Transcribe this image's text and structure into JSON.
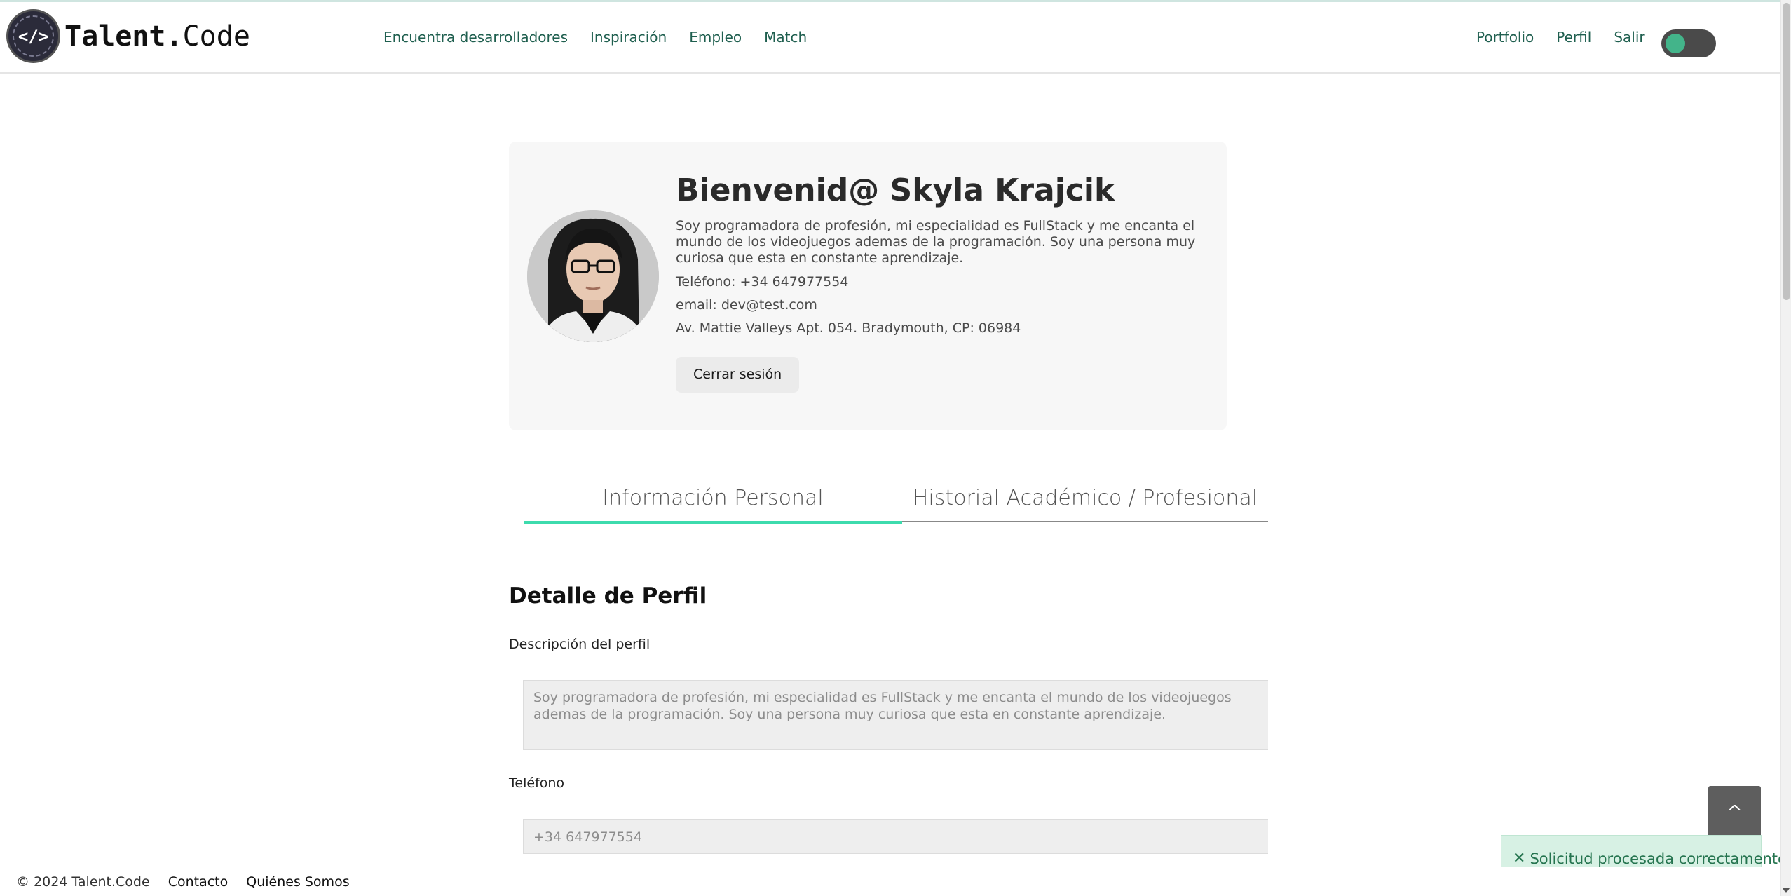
{
  "header": {
    "logo_icon": "</>",
    "logo_bold": "Talent.",
    "logo_rest": "Code",
    "nav_left": [
      "Encuentra desarrolladores",
      "Inspiración",
      "Empleo",
      "Match"
    ],
    "nav_right": [
      "Portfolio",
      "Perfil",
      "Salir"
    ],
    "theme_toggle": "on"
  },
  "profile": {
    "welcome": "Bienvenid@ Skyla Krajcik",
    "bio": "Soy programadora de profesión, mi especialidad es FullStack y me encanta el mundo de los videojuegos ademas de la programación. Soy una persona muy curiosa que esta en constante aprendizaje.",
    "phone": "Teléfono: +34 647977554",
    "email": "email: dev@test.com",
    "address": "Av. Mattie Valleys Apt. 054. Bradymouth, CP: 06984",
    "logout": "Cerrar sesión"
  },
  "tabs": [
    {
      "label": "Información Personal",
      "active": true
    },
    {
      "label": "Historial Académico / Profesional",
      "active": false
    }
  ],
  "detail": {
    "title": "Detalle de Perfil",
    "description_label": "Descripción del perfil",
    "description_value": "Soy programadora de profesión, mi especialidad es FullStack y me encanta el mundo de los videojuegos ademas de la programación. Soy una persona muy curiosa que esta en constante aprendizaje.",
    "phone_label": "Teléfono",
    "phone_value": "+34 647977554"
  },
  "scroll_top": "^",
  "toast": {
    "close": "✕",
    "message": "Solicitud procesada correctamente."
  },
  "footer": {
    "copyright": "© 2024 Talent.Code",
    "links": [
      "Contacto",
      "Quiénes Somos"
    ]
  },
  "colors": {
    "accent": "#3ddbad",
    "nav_link": "#1f5f4f",
    "toast_bg": "#d7f1e4"
  }
}
